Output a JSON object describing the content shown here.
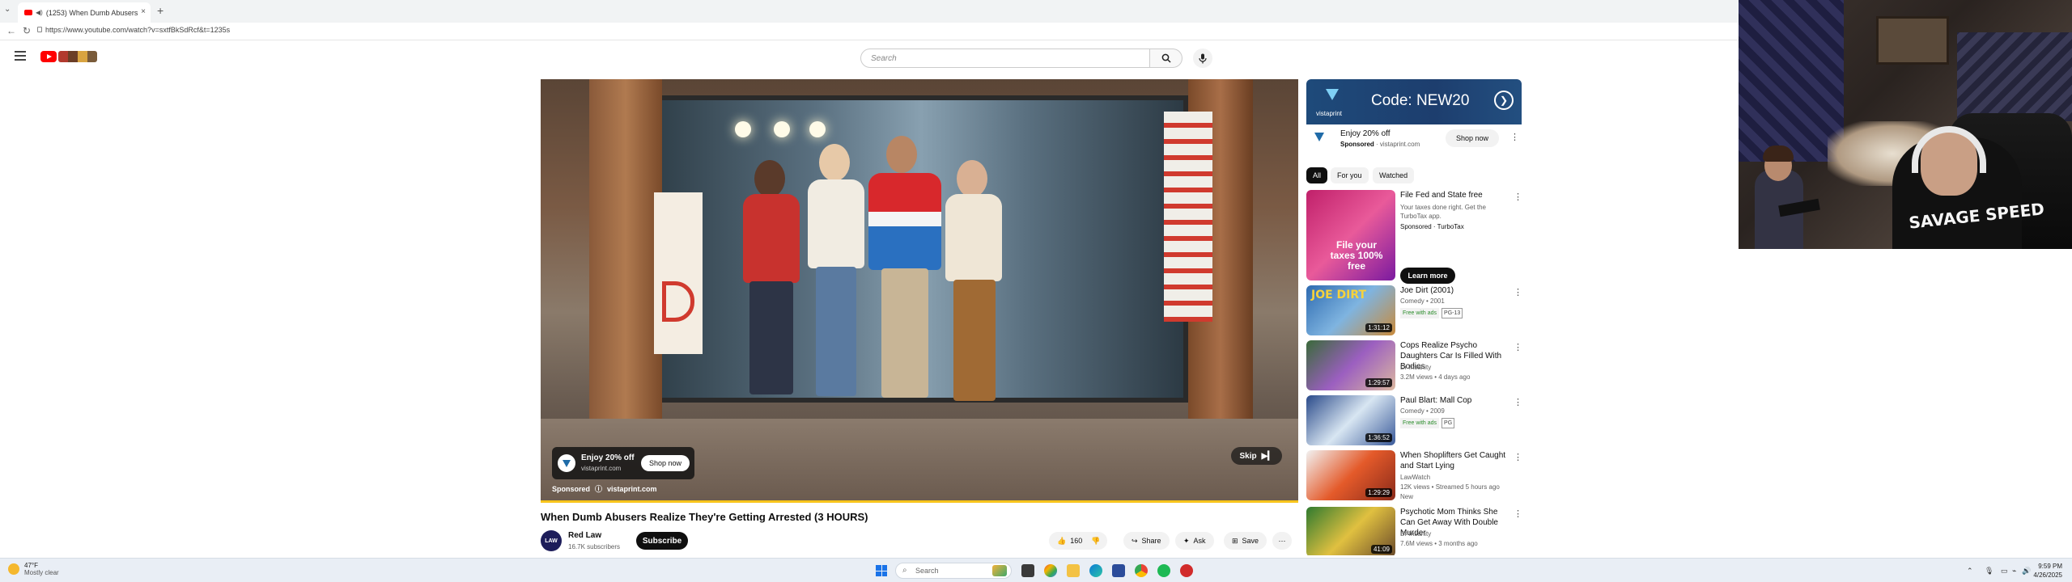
{
  "browser": {
    "tab_title": "(1253) When Dumb Abusers",
    "url": "https://www.youtube.com/watch?v=sxtfBkSdRcf&t=1235s",
    "new_tab": "+",
    "close_tab": "×"
  },
  "youtube": {
    "search_placeholder": "Search"
  },
  "player": {
    "ad_card": {
      "headline": "Enjoy 20% off",
      "domain": "vistaprint.com",
      "cta": "Shop now"
    },
    "sponsored_label": "Sponsored",
    "sponsored_domain": "vistaprint.com",
    "skip_label": "Skip",
    "storefront_text": "Donuts",
    "progress_fraction": 1.0
  },
  "video": {
    "title": "When Dumb Abusers Realize They're Getting Arrested (3 HOURS)",
    "channel": "Red Law",
    "subscribers": "16.7K subscribers",
    "avatar_text": "LAW",
    "subscribe_label": "Subscribe",
    "likes": "160",
    "share_label": "Share",
    "ask_label": "Ask",
    "save_label": "Save",
    "more_label": "⋯"
  },
  "sidebar": {
    "ad": {
      "banner_code": "Code: NEW20",
      "banner_brand": "vistaprint",
      "headline": "Enjoy 20% off",
      "sponsored": "Sponsored",
      "domain": "vistaprint.com",
      "cta": "Shop now"
    },
    "chips": [
      "All",
      "For you",
      "Watched"
    ],
    "recommendations": [
      {
        "title": "File Fed and State free",
        "meta1": "Your taxes done right. Get the TurboTax app.",
        "meta2": "Sponsored · TurboTax",
        "thumb_text": "File your taxes 100% free",
        "cta": "Learn more"
      },
      {
        "title": "Joe Dirt (2001)",
        "meta1": "Comedy • 2001",
        "free": "Free with ads",
        "rating": "PG-13",
        "duration": "1:31:12",
        "thumb_text": "JOE DIRT"
      },
      {
        "title": "Cops Realize Psycho Daughters Car Is Filled With Bodies",
        "meta1": "Dr Insanity",
        "meta2": "3.2M views • 4 days ago",
        "duration": "1:29:57"
      },
      {
        "title": "Paul Blart: Mall Cop",
        "meta1": "Comedy • 2009",
        "free": "Free with ads",
        "rating": "PG",
        "duration": "1:36:52"
      },
      {
        "title": "When Shoplifters Get Caught and Start Lying",
        "meta1": "LawWatch",
        "meta2": "12K views • Streamed 5 hours ago",
        "meta3": "New",
        "duration": "1:29:29"
      },
      {
        "title": "Psychotic Mom Thinks She Can Get Away With Double Murder",
        "meta1": "Dr Insanity",
        "meta2": "7.6M views • 3 months ago",
        "duration": "41:09"
      }
    ]
  },
  "webcam": {
    "shirt_text": "SAVAGE SPEED"
  },
  "taskbar": {
    "temperature": "47°F",
    "weather": "Mostly clear",
    "search_placeholder": "Search",
    "time": "9:59 PM",
    "date": "4/26/2025"
  }
}
